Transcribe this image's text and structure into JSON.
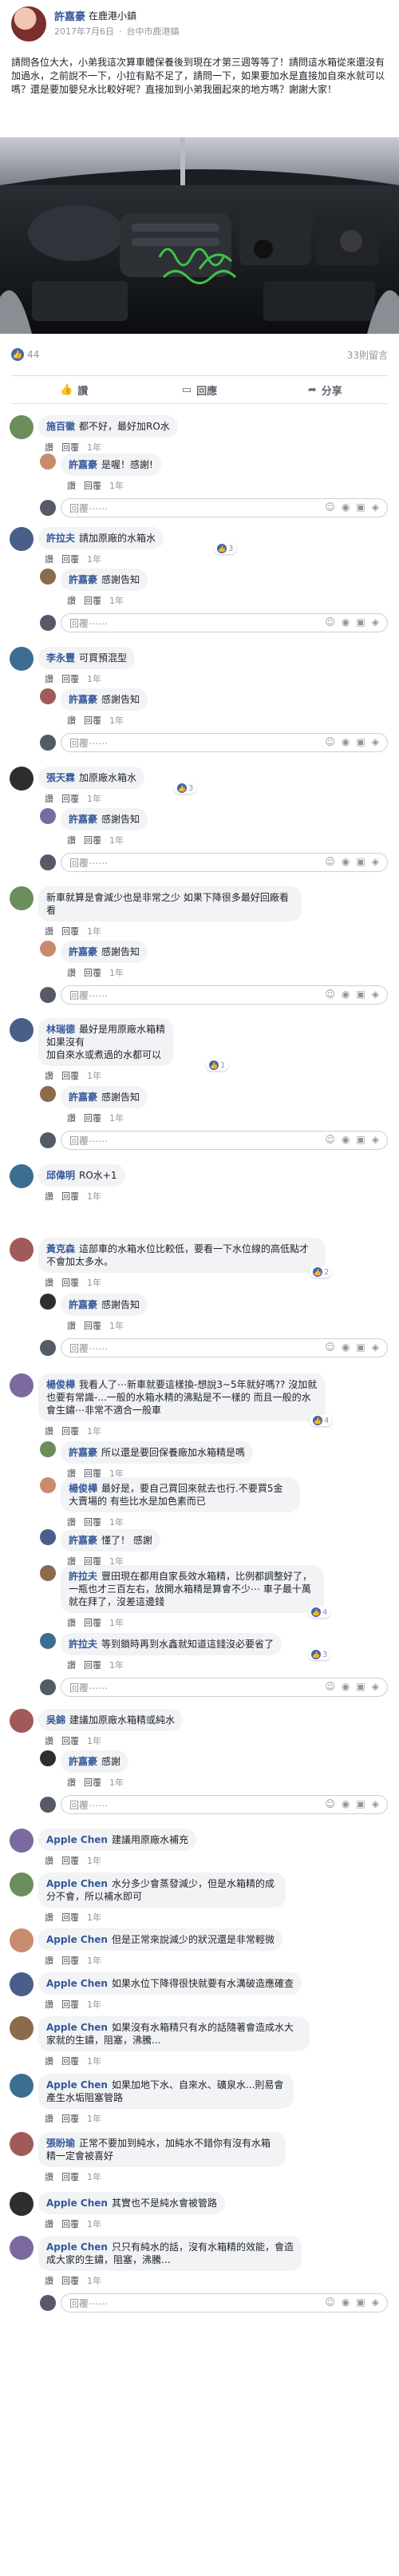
{
  "post": {
    "author": "許嘉豪",
    "location": "在鹿港小鎮",
    "date": "2017年7月6日",
    "place": "台中市鹿港鎮",
    "text": "請問各位大大，小弟我這次算車體保養後到現在才第三週等等了！請問這水箱從來還沒有加過水，之前說不一下，小拉有點不足了，請問一下，如果要加水是直接加自來水就可以嗎？還是要加嬰兒水比較好呢？直接加到小弟我圈起來的地方嗎？謝謝大家！",
    "likes": "44",
    "comments_count": "33則留言",
    "actions": {
      "like": "讚",
      "comment": "回應",
      "share": "分享"
    }
  },
  "labels": {
    "like": "讚",
    "reply": "回覆",
    "time": "1年",
    "reply_placeholder": "回覆⋯⋯"
  },
  "comments": [
    {
      "name": "施百徽",
      "text": "都不好，最好加RO水",
      "likes": ""
    },
    {
      "name": "許嘉豪",
      "text": "是喔！感謝!",
      "likes": ""
    },
    {
      "name": "許拉夫",
      "text": "請加原廠的水箱水",
      "likes": "3"
    },
    {
      "name": "許嘉豪",
      "text": "感謝告知",
      "likes": ""
    },
    {
      "name": "李永豐",
      "text": "可買預混型",
      "likes": ""
    },
    {
      "name": "許嘉豪",
      "text": "感謝告知",
      "likes": ""
    },
    {
      "name": "張天霖",
      "text": "加原廠水箱水",
      "likes": "3"
    },
    {
      "name": "許嘉豪",
      "text": "感謝告知",
      "likes": ""
    },
    {
      "name": "",
      "text": "新車就算是會減少也是非常之少 如果下降很多最好回廠看看",
      "likes": ""
    },
    {
      "name": "許嘉豪",
      "text": "感謝告知",
      "likes": ""
    },
    {
      "name": "林瑞德",
      "text": "最好是用原廠水箱精\n如果沒有\n加自來水或煮過的水都可以",
      "likes": "1"
    },
    {
      "name": "許嘉豪",
      "text": "感謝告知",
      "likes": ""
    },
    {
      "name": "邱偉明",
      "text": "RO水+1",
      "likes": ""
    },
    {
      "name": "黃克森",
      "text": "這部車的水箱水位比較低，要看一下水位線的高低點才不會加太多水。",
      "likes": "2"
    },
    {
      "name": "許嘉豪",
      "text": "感謝告知",
      "likes": ""
    },
    {
      "name": "楊俊樺",
      "text": "我看人了⋯新車就要這樣換-想說3~5年就好嗎?? 沒加就也要有常識-...一般的水箱水精的沸點是不一樣的 而且一般的水會生鏽⋯非常不適合一般車",
      "likes": "4"
    },
    {
      "name": "許嘉豪",
      "text": "所以還是要回保養廠加水箱精是嗎",
      "likes": ""
    },
    {
      "name": "楊俊樺",
      "text": "最好是，要自己買回來就去也行.不要買5金大賣場的 有些比水是加色素而已",
      "likes": ""
    },
    {
      "name": "許嘉豪",
      "text": "懂了！ 感謝",
      "likes": ""
    },
    {
      "name": "許拉夫",
      "text": "豐田現在都用自家長效水箱精，比例都調整好了，一瓶也才三百左右，放開水箱精是算會不少⋯ 車子最十萬就在拜了，沒差這邊錢",
      "likes": "4"
    },
    {
      "name": "許拉夫",
      "text": "等到鎖時再到水鑫就知道這錢沒必要省了",
      "likes": "3"
    },
    {
      "name": "吳錦",
      "text": "建議加原廠水箱精或純水",
      "likes": ""
    },
    {
      "name": "許嘉豪",
      "text": "感謝",
      "likes": ""
    },
    {
      "name": "Apple Chen",
      "text": "建議用原廠水補充",
      "likes": ""
    },
    {
      "name": "Apple Chen",
      "text": "水分多少會蒸發減少，但是水箱精的成分不會，所以補水即可",
      "likes": ""
    },
    {
      "name": "Apple Chen",
      "text": "但是正常來說減少的狀況還是非常輕微",
      "likes": ""
    },
    {
      "name": "Apple Chen",
      "text": "如果水位下降得很快就要有水溝破造應確查",
      "likes": ""
    },
    {
      "name": "Apple Chen",
      "text": "如果沒有水箱精只有水的話隨著會造成水大家就的生鏽，阻塞，沸騰...",
      "likes": ""
    },
    {
      "name": "Apple Chen",
      "text": "如果加地下水、自來水、礦泉水...則易會產生水垢阻塞管路",
      "likes": ""
    },
    {
      "name": "張盼瑜",
      "text": "正常不要加到純水，加純水不錯你有沒有水箱精一定會被喜好",
      "likes": ""
    },
    {
      "name": "Apple Chen",
      "text": "其實也不是純水會被管路",
      "likes": ""
    },
    {
      "name": "Apple Chen",
      "text": "只只有純水的話，沒有水箱精的效能，會造成大家的生鏽，阻塞，沸騰...",
      "likes": ""
    }
  ],
  "colors": {
    "link": "#365899",
    "bubble": "#f2f3f5",
    "meta": "#90949c",
    "accent": "#4267b2"
  }
}
